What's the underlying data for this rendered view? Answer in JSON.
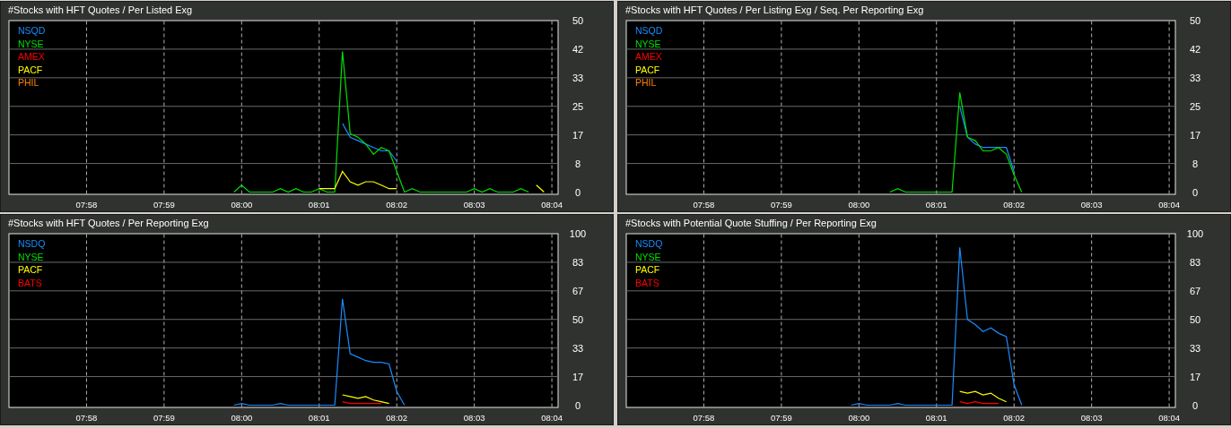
{
  "panels": [
    {
      "chart_data": {
        "type": "line",
        "grid": true,
        "title": "#Stocks with HFT Quotes / Per Listed Exg",
        "ylim": [
          0,
          50
        ],
        "categories": [
          null,
          null,
          null,
          null,
          null,
          null,
          null,
          null,
          null,
          null,
          "07:58",
          null,
          null,
          null,
          null,
          null,
          null,
          null,
          null,
          null,
          "07:59",
          null,
          null,
          null,
          null,
          null,
          null,
          null,
          null,
          null,
          "08:00",
          null,
          null,
          null,
          null,
          null,
          null,
          null,
          null,
          null,
          "08:01",
          null,
          null,
          null,
          null,
          null,
          null,
          null,
          null,
          null,
          "08:02",
          null,
          null,
          null,
          null,
          null,
          null,
          null,
          null,
          null,
          "08:03",
          null,
          null,
          null,
          null,
          null,
          null,
          null,
          null,
          null,
          "08:04"
        ],
        "yticks": [
          0,
          {
            "value": 8.33,
            "label": "8"
          },
          {
            "value": 16.67,
            "label": "17"
          },
          25,
          {
            "value": 33.33,
            "label": "33"
          },
          {
            "value": 41.67,
            "label": "42"
          },
          50
        ],
        "series": [
          {
            "name": "NSQD",
            "color": "#1a8cff",
            "values": [
              null,
              null,
              null,
              null,
              null,
              null,
              null,
              null,
              null,
              null,
              null,
              null,
              null,
              null,
              null,
              null,
              null,
              null,
              null,
              null,
              null,
              null,
              null,
              null,
              null,
              null,
              null,
              null,
              null,
              null,
              null,
              null,
              null,
              null,
              null,
              null,
              null,
              null,
              null,
              null,
              null,
              null,
              null,
              20,
              16,
              15,
              14,
              13,
              12,
              12,
              9,
              null,
              null,
              null,
              null,
              null,
              null,
              null,
              null,
              null,
              null,
              null,
              null,
              null,
              null,
              null,
              null,
              null,
              null,
              null,
              null
            ]
          },
          {
            "name": "NYSE",
            "color": "#00e000",
            "values": [
              null,
              null,
              null,
              null,
              null,
              null,
              null,
              null,
              null,
              null,
              null,
              null,
              null,
              null,
              null,
              null,
              null,
              null,
              null,
              null,
              null,
              null,
              null,
              null,
              null,
              null,
              null,
              null,
              null,
              0,
              2,
              0,
              0,
              0,
              0,
              1,
              0,
              1,
              0,
              0,
              1,
              0,
              0,
              41,
              17,
              16,
              14,
              11,
              13,
              12,
              6,
              0,
              1,
              0,
              0,
              0,
              0,
              0,
              0,
              0,
              1,
              0,
              1,
              0,
              0,
              0,
              1,
              0,
              null,
              null,
              null
            ]
          },
          {
            "name": "AMEX",
            "color": "#ff0000",
            "values": [
              null,
              null,
              null,
              null,
              null,
              null,
              null,
              null,
              null,
              null,
              null,
              null,
              null,
              null,
              null,
              null,
              null,
              null,
              null,
              null,
              null,
              null,
              null,
              null,
              null,
              null,
              null,
              null,
              null,
              null,
              null,
              null,
              null,
              null,
              null,
              null,
              null,
              null,
              null,
              null,
              null,
              null,
              null,
              null,
              null,
              null,
              null,
              null,
              null,
              null,
              null,
              null,
              null,
              null,
              null,
              null,
              null,
              null,
              null,
              null,
              null,
              null,
              null,
              null,
              null,
              null,
              null,
              null,
              null,
              null,
              null
            ]
          },
          {
            "name": "PACF",
            "color": "#ffff00",
            "values": [
              null,
              null,
              null,
              null,
              null,
              null,
              null,
              null,
              null,
              null,
              null,
              null,
              null,
              null,
              null,
              null,
              null,
              null,
              null,
              null,
              null,
              null,
              null,
              null,
              null,
              null,
              null,
              null,
              null,
              null,
              null,
              null,
              null,
              null,
              null,
              null,
              null,
              null,
              null,
              null,
              1,
              1,
              1,
              6,
              3,
              2,
              3,
              3,
              2,
              1,
              1,
              null,
              null,
              null,
              null,
              null,
              null,
              null,
              null,
              null,
              null,
              null,
              null,
              null,
              null,
              null,
              null,
              null,
              2,
              0,
              null
            ]
          },
          {
            "name": "PHIL",
            "color": "#ff8000",
            "values": [
              null,
              null,
              null,
              null,
              null,
              null,
              null,
              null,
              null,
              null,
              null,
              null,
              null,
              null,
              null,
              null,
              null,
              null,
              null,
              null,
              null,
              null,
              null,
              null,
              null,
              null,
              null,
              null,
              null,
              null,
              null,
              null,
              null,
              null,
              null,
              null,
              null,
              null,
              null,
              null,
              null,
              null,
              null,
              null,
              null,
              null,
              null,
              null,
              null,
              null,
              null,
              null,
              null,
              null,
              null,
              null,
              null,
              null,
              null,
              null,
              null,
              null,
              null,
              null,
              null,
              null,
              null,
              null,
              null,
              null,
              null
            ]
          }
        ]
      }
    },
    {
      "chart_data": {
        "type": "line",
        "grid": true,
        "title": "#Stocks with HFT Quotes / Per Listing Exg / Seq. Per Reporting Exg",
        "ylim": [
          0,
          50
        ],
        "categories": [
          null,
          null,
          null,
          null,
          null,
          null,
          null,
          null,
          null,
          null,
          "07:58",
          null,
          null,
          null,
          null,
          null,
          null,
          null,
          null,
          null,
          "07:59",
          null,
          null,
          null,
          null,
          null,
          null,
          null,
          null,
          null,
          "08:00",
          null,
          null,
          null,
          null,
          null,
          null,
          null,
          null,
          null,
          "08:01",
          null,
          null,
          null,
          null,
          null,
          null,
          null,
          null,
          null,
          "08:02",
          null,
          null,
          null,
          null,
          null,
          null,
          null,
          null,
          null,
          "08:03",
          null,
          null,
          null,
          null,
          null,
          null,
          null,
          null,
          null,
          "08:04"
        ],
        "yticks": [
          0,
          {
            "value": 8.33,
            "label": "8"
          },
          {
            "value": 16.67,
            "label": "17"
          },
          25,
          {
            "value": 33.33,
            "label": "33"
          },
          {
            "value": 41.67,
            "label": "42"
          },
          50
        ],
        "series": [
          {
            "name": "NSQD",
            "color": "#1a8cff",
            "values": [
              null,
              null,
              null,
              null,
              null,
              null,
              null,
              null,
              null,
              null,
              null,
              null,
              null,
              null,
              null,
              null,
              null,
              null,
              null,
              null,
              null,
              null,
              null,
              null,
              null,
              null,
              null,
              null,
              null,
              null,
              null,
              null,
              null,
              null,
              null,
              null,
              null,
              null,
              null,
              null,
              null,
              null,
              null,
              25,
              16,
              14,
              13,
              13,
              13,
              13,
              6,
              null,
              null,
              null,
              null,
              null,
              null,
              null,
              null,
              null,
              null,
              null,
              null,
              null,
              null,
              null,
              null,
              null,
              null,
              null,
              null
            ]
          },
          {
            "name": "NYSE",
            "color": "#00e000",
            "values": [
              null,
              null,
              null,
              null,
              null,
              null,
              null,
              null,
              null,
              null,
              null,
              null,
              null,
              null,
              null,
              null,
              null,
              null,
              null,
              null,
              null,
              null,
              null,
              null,
              null,
              null,
              null,
              null,
              null,
              null,
              null,
              null,
              null,
              null,
              0,
              1,
              0,
              0,
              0,
              0,
              0,
              0,
              0,
              29,
              16,
              15,
              12,
              12,
              13,
              11,
              5,
              0,
              null,
              null,
              null,
              null,
              null,
              null,
              null,
              null,
              null,
              null,
              null,
              null,
              null,
              null,
              null,
              null,
              null,
              null,
              null
            ]
          },
          {
            "name": "AMEX",
            "color": "#ff0000",
            "values": [
              null,
              null,
              null,
              null,
              null,
              null,
              null,
              null,
              null,
              null,
              null,
              null,
              null,
              null,
              null,
              null,
              null,
              null,
              null,
              null,
              null,
              null,
              null,
              null,
              null,
              null,
              null,
              null,
              null,
              null,
              null,
              null,
              null,
              null,
              null,
              null,
              null,
              null,
              null,
              null,
              null,
              null,
              null,
              null,
              null,
              null,
              null,
              null,
              null,
              null,
              null,
              null,
              null,
              null,
              null,
              null,
              null,
              null,
              null,
              null,
              null,
              null,
              null,
              null,
              null,
              null,
              null,
              null,
              null,
              null,
              null
            ]
          },
          {
            "name": "PACF",
            "color": "#ffff00",
            "values": [
              null,
              null,
              null,
              null,
              null,
              null,
              null,
              null,
              null,
              null,
              null,
              null,
              null,
              null,
              null,
              null,
              null,
              null,
              null,
              null,
              null,
              null,
              null,
              null,
              null,
              null,
              null,
              null,
              null,
              null,
              null,
              null,
              null,
              null,
              null,
              null,
              null,
              null,
              null,
              null,
              null,
              null,
              null,
              null,
              null,
              null,
              null,
              null,
              null,
              null,
              null,
              null,
              null,
              null,
              null,
              null,
              null,
              null,
              null,
              null,
              null,
              null,
              null,
              null,
              null,
              null,
              null,
              null,
              null,
              null,
              null
            ]
          },
          {
            "name": "PHIL",
            "color": "#ff8000",
            "values": [
              null,
              null,
              null,
              null,
              null,
              null,
              null,
              null,
              null,
              null,
              null,
              null,
              null,
              null,
              null,
              null,
              null,
              null,
              null,
              null,
              null,
              null,
              null,
              null,
              null,
              null,
              null,
              null,
              null,
              null,
              null,
              null,
              null,
              null,
              null,
              null,
              null,
              null,
              null,
              null,
              null,
              null,
              null,
              null,
              null,
              null,
              null,
              null,
              null,
              null,
              null,
              null,
              null,
              null,
              null,
              null,
              null,
              null,
              null,
              null,
              null,
              null,
              null,
              null,
              null,
              null,
              null,
              null,
              null,
              null,
              null
            ]
          }
        ]
      }
    },
    {
      "chart_data": {
        "type": "line",
        "grid": true,
        "title": "#Stocks with HFT Quotes / Per Reporting Exg",
        "ylim": [
          0,
          100
        ],
        "categories": [
          null,
          null,
          null,
          null,
          null,
          null,
          null,
          null,
          null,
          null,
          "07:58",
          null,
          null,
          null,
          null,
          null,
          null,
          null,
          null,
          null,
          "07:59",
          null,
          null,
          null,
          null,
          null,
          null,
          null,
          null,
          null,
          "08:00",
          null,
          null,
          null,
          null,
          null,
          null,
          null,
          null,
          null,
          "08:01",
          null,
          null,
          null,
          null,
          null,
          null,
          null,
          null,
          null,
          "08:02",
          null,
          null,
          null,
          null,
          null,
          null,
          null,
          null,
          null,
          "08:03",
          null,
          null,
          null,
          null,
          null,
          null,
          null,
          null,
          null,
          "08:04"
        ],
        "yticks": [
          0,
          {
            "value": 16.67,
            "label": "17"
          },
          {
            "value": 33.33,
            "label": "33"
          },
          50,
          {
            "value": 66.67,
            "label": "67"
          },
          {
            "value": 83.33,
            "label": "83"
          },
          100
        ],
        "series": [
          {
            "name": "NSDQ",
            "color": "#1a8cff",
            "values": [
              null,
              null,
              null,
              null,
              null,
              null,
              null,
              null,
              null,
              null,
              null,
              null,
              null,
              null,
              null,
              null,
              null,
              null,
              null,
              null,
              null,
              null,
              null,
              null,
              null,
              null,
              null,
              null,
              null,
              0,
              1,
              0,
              0,
              0,
              0,
              1,
              0,
              0,
              0,
              0,
              0,
              0,
              0,
              62,
              30,
              28,
              26,
              25,
              25,
              24,
              8,
              0,
              null,
              null,
              null,
              null,
              null,
              null,
              null,
              null,
              null,
              null,
              null,
              null,
              null,
              null,
              null,
              null,
              null,
              null,
              null
            ]
          },
          {
            "name": "NYSE",
            "color": "#00e000",
            "values": [
              null,
              null,
              null,
              null,
              null,
              null,
              null,
              null,
              null,
              null,
              null,
              null,
              null,
              null,
              null,
              null,
              null,
              null,
              null,
              null,
              null,
              null,
              null,
              null,
              null,
              null,
              null,
              null,
              null,
              null,
              null,
              null,
              null,
              null,
              null,
              null,
              null,
              null,
              null,
              null,
              null,
              null,
              null,
              null,
              null,
              null,
              null,
              null,
              null,
              null,
              null,
              null,
              null,
              null,
              null,
              null,
              null,
              null,
              null,
              null,
              null,
              null,
              null,
              null,
              null,
              null,
              null,
              null,
              null,
              null,
              null
            ]
          },
          {
            "name": "PACF",
            "color": "#ffff00",
            "values": [
              null,
              null,
              null,
              null,
              null,
              null,
              null,
              null,
              null,
              null,
              null,
              null,
              null,
              null,
              null,
              null,
              null,
              null,
              null,
              null,
              null,
              null,
              null,
              null,
              null,
              null,
              null,
              null,
              null,
              null,
              null,
              null,
              null,
              null,
              null,
              null,
              null,
              null,
              null,
              null,
              null,
              null,
              null,
              6,
              5,
              4,
              5,
              3,
              2,
              1,
              null,
              null,
              null,
              null,
              null,
              null,
              null,
              null,
              null,
              null,
              null,
              null,
              null,
              null,
              null,
              null,
              null,
              null,
              null,
              null,
              null
            ]
          },
          {
            "name": "BATS",
            "color": "#ff0000",
            "values": [
              null,
              null,
              null,
              null,
              null,
              null,
              null,
              null,
              null,
              null,
              null,
              null,
              null,
              null,
              null,
              null,
              null,
              null,
              null,
              null,
              null,
              null,
              null,
              null,
              null,
              null,
              null,
              null,
              null,
              null,
              null,
              null,
              null,
              null,
              null,
              null,
              null,
              null,
              null,
              null,
              null,
              null,
              null,
              2,
              1,
              1,
              1,
              1,
              1,
              null,
              null,
              null,
              null,
              null,
              null,
              null,
              null,
              null,
              null,
              null,
              null,
              null,
              null,
              null,
              null,
              null,
              null,
              null,
              null,
              null,
              null
            ]
          }
        ]
      }
    },
    {
      "chart_data": {
        "type": "line",
        "grid": true,
        "title": "#Stocks with Potential Quote Stuffing / Per Reporting Exg",
        "ylim": [
          0,
          100
        ],
        "categories": [
          null,
          null,
          null,
          null,
          null,
          null,
          null,
          null,
          null,
          null,
          "07:58",
          null,
          null,
          null,
          null,
          null,
          null,
          null,
          null,
          null,
          "07:59",
          null,
          null,
          null,
          null,
          null,
          null,
          null,
          null,
          null,
          "08:00",
          null,
          null,
          null,
          null,
          null,
          null,
          null,
          null,
          null,
          "08:01",
          null,
          null,
          null,
          null,
          null,
          null,
          null,
          null,
          null,
          "08:02",
          null,
          null,
          null,
          null,
          null,
          null,
          null,
          null,
          null,
          "08:03",
          null,
          null,
          null,
          null,
          null,
          null,
          null,
          null,
          null,
          "08:04"
        ],
        "yticks": [
          0,
          {
            "value": 16.67,
            "label": "17"
          },
          {
            "value": 33.33,
            "label": "33"
          },
          50,
          {
            "value": 66.67,
            "label": "67"
          },
          {
            "value": 83.33,
            "label": "83"
          },
          100
        ],
        "series": [
          {
            "name": "NSDQ",
            "color": "#1a8cff",
            "values": [
              null,
              null,
              null,
              null,
              null,
              null,
              null,
              null,
              null,
              null,
              null,
              null,
              null,
              null,
              null,
              null,
              null,
              null,
              null,
              null,
              null,
              null,
              null,
              null,
              null,
              null,
              null,
              null,
              null,
              0,
              1,
              0,
              0,
              0,
              0,
              1,
              0,
              0,
              0,
              0,
              0,
              0,
              0,
              92,
              50,
              47,
              43,
              45,
              42,
              40,
              12,
              0,
              null,
              null,
              null,
              null,
              null,
              null,
              null,
              null,
              null,
              null,
              null,
              null,
              null,
              null,
              null,
              null,
              null,
              null,
              null
            ]
          },
          {
            "name": "NYSE",
            "color": "#00e000",
            "values": [
              null,
              null,
              null,
              null,
              null,
              null,
              null,
              null,
              null,
              null,
              null,
              null,
              null,
              null,
              null,
              null,
              null,
              null,
              null,
              null,
              null,
              null,
              null,
              null,
              null,
              null,
              null,
              null,
              null,
              null,
              null,
              null,
              null,
              null,
              null,
              null,
              null,
              null,
              null,
              null,
              null,
              null,
              null,
              null,
              null,
              null,
              null,
              null,
              null,
              null,
              null,
              null,
              null,
              null,
              null,
              null,
              null,
              null,
              null,
              null,
              null,
              null,
              null,
              null,
              null,
              null,
              null,
              null,
              null,
              null,
              null
            ]
          },
          {
            "name": "PACF",
            "color": "#ffff00",
            "values": [
              null,
              null,
              null,
              null,
              null,
              null,
              null,
              null,
              null,
              null,
              null,
              null,
              null,
              null,
              null,
              null,
              null,
              null,
              null,
              null,
              null,
              null,
              null,
              null,
              null,
              null,
              null,
              null,
              null,
              null,
              null,
              null,
              null,
              null,
              null,
              null,
              null,
              null,
              null,
              null,
              null,
              null,
              null,
              8,
              7,
              8,
              6,
              7,
              4,
              2,
              null,
              null,
              null,
              null,
              null,
              null,
              null,
              null,
              null,
              null,
              null,
              null,
              null,
              null,
              null,
              null,
              null,
              null,
              null,
              null,
              null
            ]
          },
          {
            "name": "BATS",
            "color": "#ff0000",
            "values": [
              null,
              null,
              null,
              null,
              null,
              null,
              null,
              null,
              null,
              null,
              null,
              null,
              null,
              null,
              null,
              null,
              null,
              null,
              null,
              null,
              null,
              null,
              null,
              null,
              null,
              null,
              null,
              null,
              null,
              null,
              null,
              null,
              null,
              null,
              null,
              null,
              null,
              null,
              null,
              null,
              null,
              null,
              null,
              2,
              1,
              2,
              1,
              1,
              1,
              null,
              null,
              null,
              null,
              null,
              null,
              null,
              null,
              null,
              null,
              null,
              null,
              null,
              null,
              null,
              null,
              null,
              null,
              null,
              null,
              null,
              null
            ]
          }
        ]
      }
    }
  ]
}
